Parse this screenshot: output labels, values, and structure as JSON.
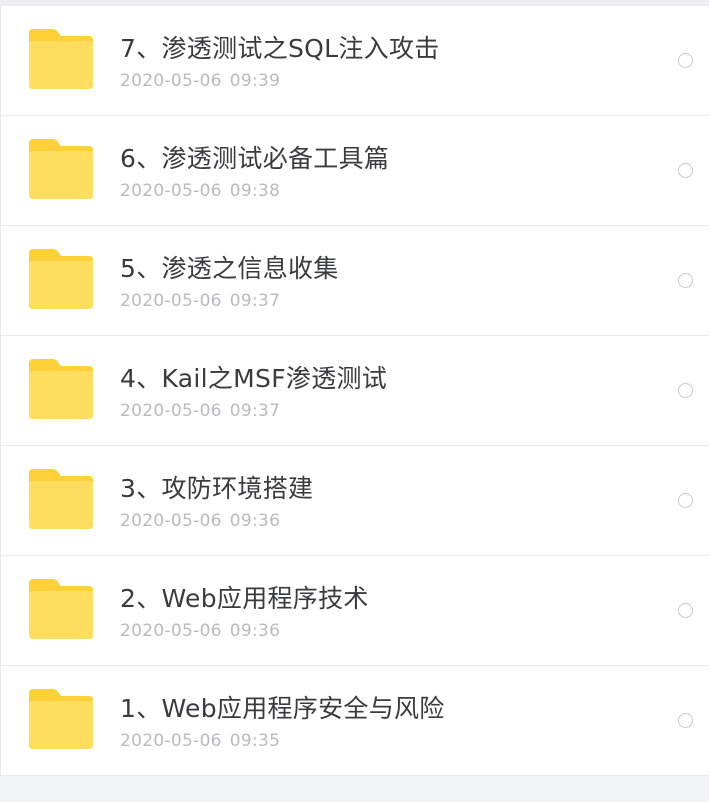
{
  "colors": {
    "folder_back": "#FFD138",
    "folder_front": "#FFDE5F",
    "name_text": "#3A3B3F",
    "date_text": "#B9BBC0",
    "background": "#F3F4F6"
  },
  "files": [
    {
      "name": "7、渗透测试之SQL注入攻击",
      "date": "2020-05-06",
      "time": "09:39",
      "icon": "folder-icon"
    },
    {
      "name": "6、渗透测试必备工具篇",
      "date": "2020-05-06",
      "time": "09:38",
      "icon": "folder-icon"
    },
    {
      "name": "5、渗透之信息收集",
      "date": "2020-05-06",
      "time": "09:37",
      "icon": "folder-icon"
    },
    {
      "name": "4、Kail之MSF渗透测试",
      "date": "2020-05-06",
      "time": "09:37",
      "icon": "folder-icon"
    },
    {
      "name": "3、攻防环境搭建",
      "date": "2020-05-06",
      "time": "09:36",
      "icon": "folder-icon"
    },
    {
      "name": "2、Web应用程序技术",
      "date": "2020-05-06",
      "time": "09:36",
      "icon": "folder-icon"
    },
    {
      "name": "1、Web应用程序安全与风险",
      "date": "2020-05-06",
      "time": "09:35",
      "icon": "folder-icon"
    }
  ]
}
